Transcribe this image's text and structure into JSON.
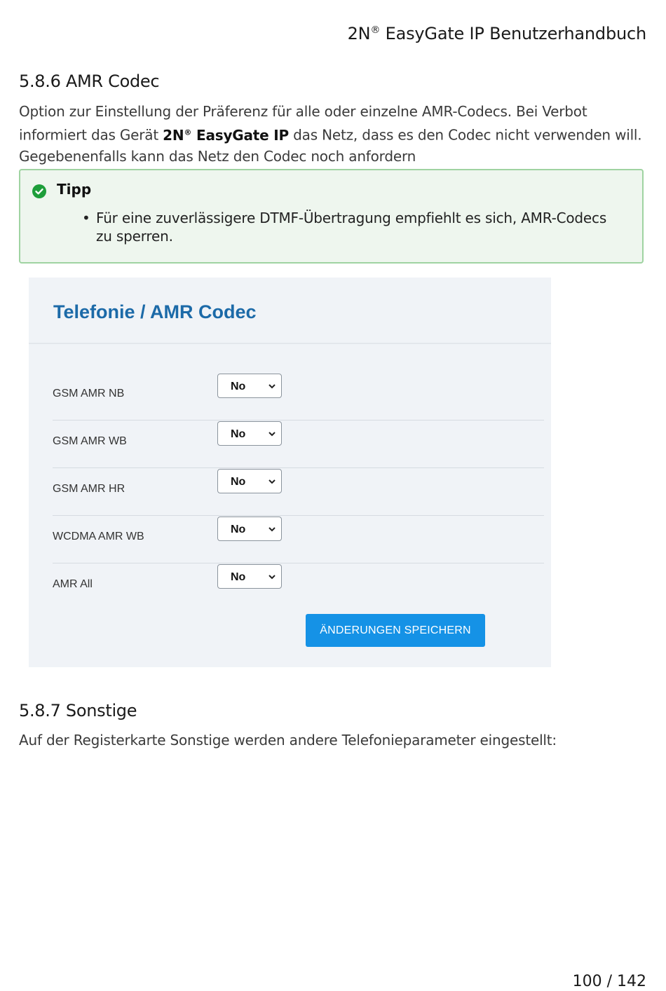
{
  "header": {
    "brand": "2N",
    "registered": "®",
    "title_rest": "EasyGate IP Benutzerhandbuch"
  },
  "section_amr": {
    "title": "5.8.6 AMR Codec",
    "para_part1": "Option zur Einstellung der Präferenz für alle oder einzelne AMR-Codecs. Bei Verbot informiert das Gerät ",
    "product_brand": "2N",
    "product_registered": "®",
    "product_name": " EasyGate IP",
    "para_part2": " das Netz, dass es den Codec nicht verwenden will. Gegebenenfalls kann das Netz den Codec noch anfordern"
  },
  "tip": {
    "title": "Tipp",
    "icon": "check-circle-icon",
    "items": [
      "Für eine zuverlässigere DTMF-Übertragung empfiehlt es sich, AMR-Codecs zu sperren."
    ]
  },
  "panel": {
    "title": "Telefonie / AMR Codec",
    "rows": [
      {
        "label": "GSM AMR NB",
        "value": "No"
      },
      {
        "label": "GSM AMR WB",
        "value": "No"
      },
      {
        "label": "GSM AMR HR",
        "value": "No"
      },
      {
        "label": "WCDMA AMR WB",
        "value": "No"
      },
      {
        "label": "AMR All",
        "value": "No"
      }
    ],
    "save_label": "ÄNDERUNGEN SPEICHERN"
  },
  "section_other": {
    "title": "5.8.7 Sonstige",
    "para": "Auf der Registerkarte Sonstige werden andere Telefonieparameter eingestellt:"
  },
  "footer": {
    "page": "100 / 142"
  },
  "colors": {
    "panel_title": "#1c6aa8",
    "button": "#1592e6",
    "tip_border": "#9fd3a1",
    "tip_icon": "#1e9e3a"
  }
}
